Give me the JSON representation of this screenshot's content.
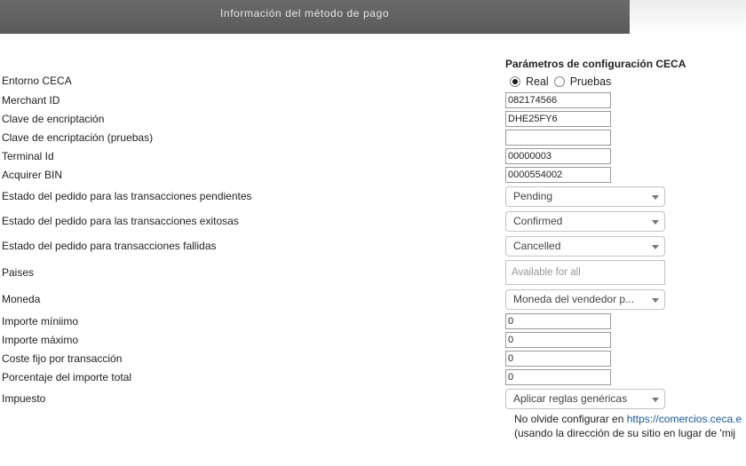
{
  "header": {
    "title": "Información del método de pago"
  },
  "section": {
    "title": "Parámetros de configuración CECA"
  },
  "fields": {
    "entorno": {
      "label": "Entorno CECA",
      "options": [
        "Real",
        "Pruebas"
      ],
      "selected": "Real"
    },
    "merchant_id": {
      "label": "Merchant ID",
      "value": "082174566"
    },
    "clave": {
      "label": "Clave de encriptación",
      "value": "DHE25FY6"
    },
    "clave_pruebas": {
      "label": "Clave de encriptación (pruebas)",
      "value": ""
    },
    "terminal": {
      "label": "Terminal Id",
      "value": "00000003"
    },
    "acquirer": {
      "label": "Acquirer BIN",
      "value": "0000554002"
    },
    "estado_pendientes": {
      "label": "Estado del pedido para las transacciones pendientes",
      "value": "Pending"
    },
    "estado_exitosas": {
      "label": "Estado del pedido para las transacciones exitosas",
      "value": "Confirmed"
    },
    "estado_fallidas": {
      "label": "Estado del pedido para transacciones fallidas",
      "value": "Cancelled"
    },
    "paises": {
      "label": "Paises",
      "placeholder": "Available for all"
    },
    "moneda": {
      "label": "Moneda",
      "value": "Moneda del vendedor p..."
    },
    "importe_min": {
      "label": "Importe míniimo",
      "value": "0"
    },
    "importe_max": {
      "label": "Importe máximo",
      "value": "0"
    },
    "coste_fijo": {
      "label": "Coste fijo por transacción",
      "value": "0"
    },
    "porcentaje": {
      "label": "Porcentaje del importe total",
      "value": "0"
    },
    "impuesto": {
      "label": "Impuesto",
      "value": "Aplicar reglas genéricas"
    }
  },
  "note": {
    "line1_prefix": "No olvide configurar en ",
    "link": "https://comercios.ceca.e",
    "line2": "(usando la dirección de su sitio en lugar de 'mij"
  }
}
